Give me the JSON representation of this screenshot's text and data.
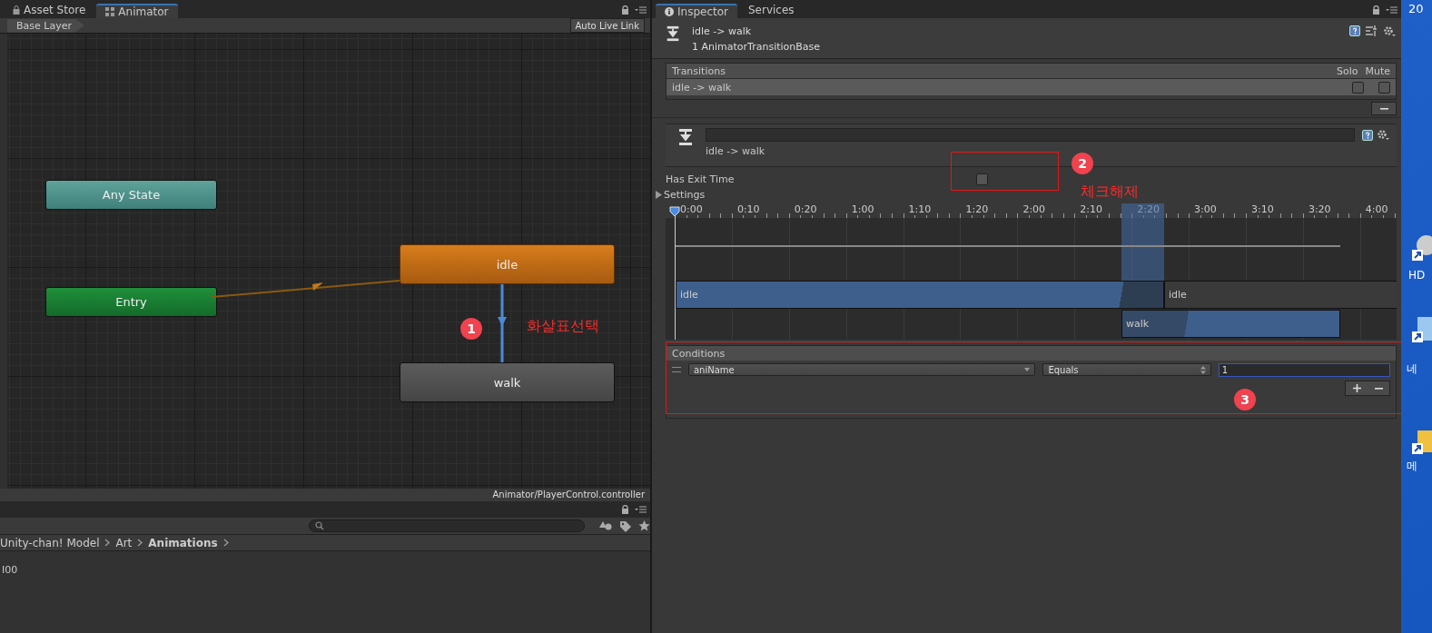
{
  "animator_tabs": [
    {
      "label": "Asset Store",
      "selected": false
    },
    {
      "label": "Animator",
      "selected": true
    }
  ],
  "animator": {
    "breadcrumb": "Base Layer",
    "live_link": "Auto Live Link",
    "footer": "Animator/PlayerControl.controller",
    "nodes": [
      {
        "label": "Any State",
        "kind": "any"
      },
      {
        "label": "Entry",
        "kind": "entry"
      },
      {
        "label": "idle",
        "kind": "default"
      },
      {
        "label": "walk",
        "kind": "state"
      }
    ]
  },
  "project": {
    "breadcrumb": [
      {
        "label": "Unity-chan! Model",
        "current": false
      },
      {
        "label": "Art",
        "current": false
      },
      {
        "label": "Animations",
        "current": true
      }
    ],
    "items": [
      "I00"
    ]
  },
  "inspector_tabs": [
    {
      "label": "Inspector",
      "selected": true
    },
    {
      "label": "Services",
      "selected": false
    }
  ],
  "inspector": {
    "title": "idle -> walk",
    "subtitle": "1 AnimatorTransitionBase",
    "transitions": {
      "header": "Transitions",
      "solo": "Solo",
      "mute": "Mute",
      "rows": [
        {
          "label": "idle -> walk",
          "selected": true,
          "solo": false,
          "mute": false
        }
      ]
    },
    "transition_name": "idle -> walk",
    "has_exit_time": {
      "label": "Has Exit Time",
      "checked": false
    },
    "settings": {
      "label": "Settings",
      "expanded": false
    },
    "timeline": {
      "ticks": [
        "0:00",
        "0:10",
        "0:20",
        "1:00",
        "1:10",
        "1:20",
        "2:00",
        "2:10",
        "2:20",
        "3:00",
        "3:10",
        "3:20",
        "4:00"
      ],
      "source": "idle",
      "source_after": "idle",
      "destination": "walk"
    },
    "conditions": {
      "header": "Conditions",
      "rows": [
        {
          "parameter": "aniName",
          "mode": "Equals",
          "value": "1"
        }
      ]
    }
  },
  "annotations": [
    {
      "number": "1",
      "text": "화살표선택"
    },
    {
      "number": "2",
      "text": "체크해제"
    },
    {
      "number": "3"
    }
  ],
  "desktop": {
    "labels": [
      "20",
      "HD",
      "네",
      "메"
    ]
  }
}
